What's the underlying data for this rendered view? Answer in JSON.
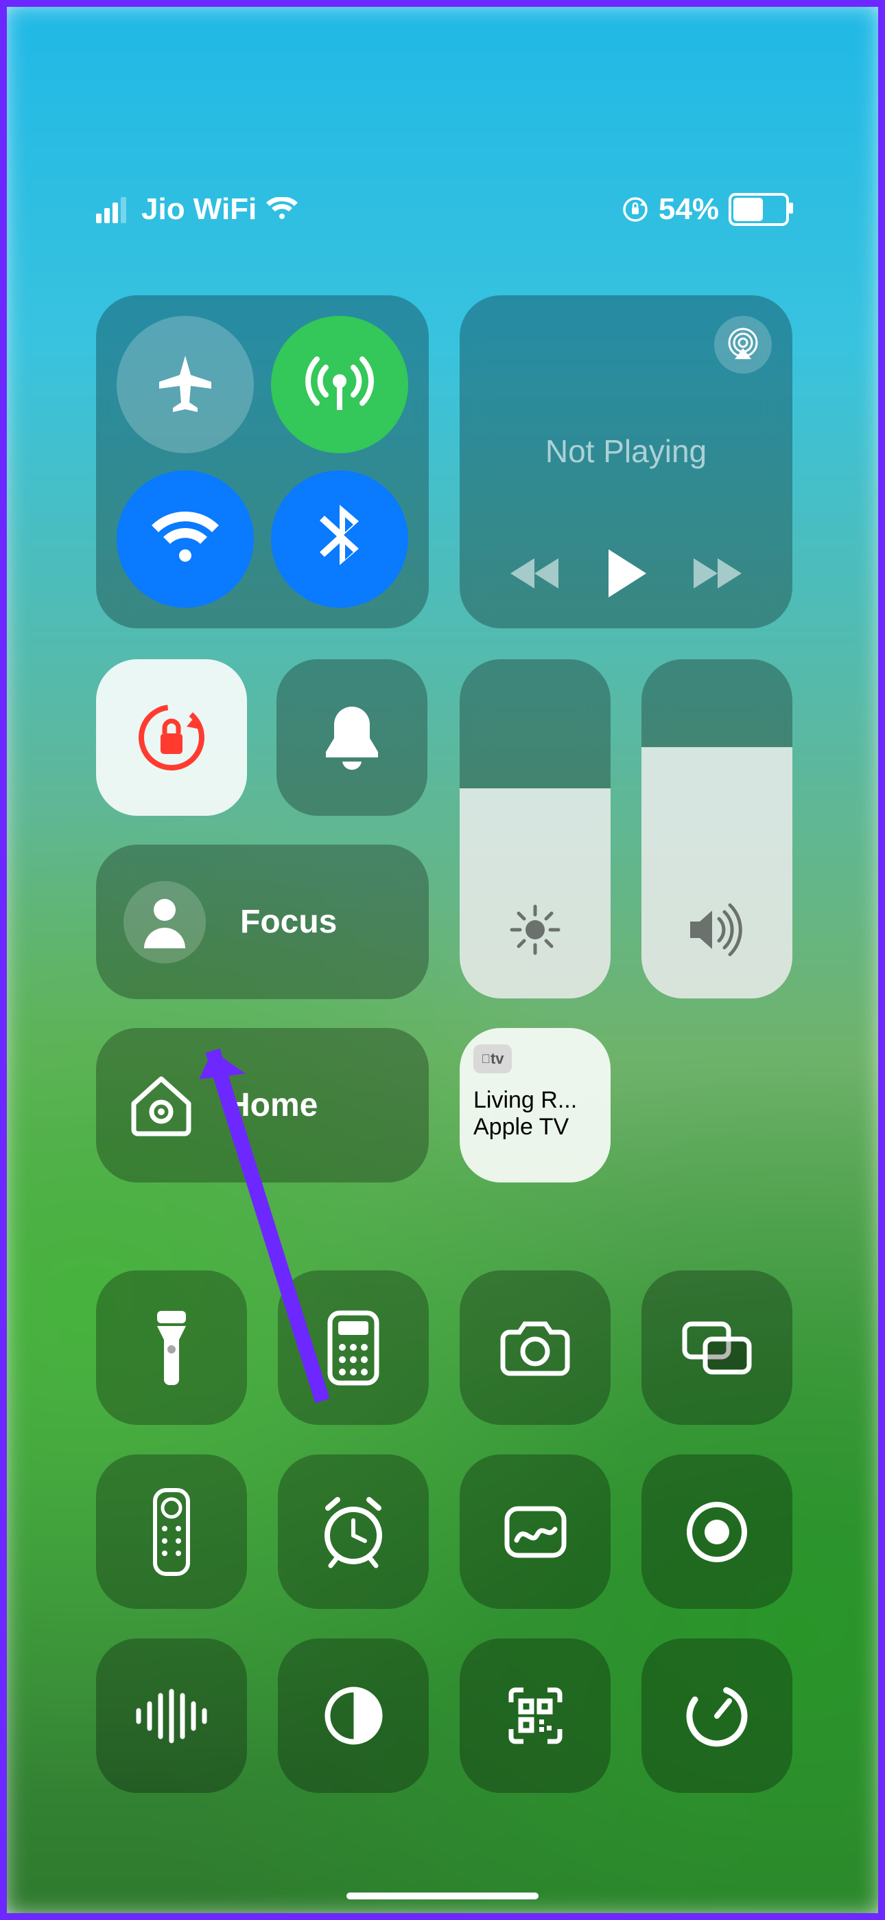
{
  "status": {
    "carrier": "Jio WiFi",
    "battery_percent": "54%"
  },
  "connectivity": {
    "airplane": {
      "on": false,
      "icon": "airplane-icon"
    },
    "cellular": {
      "on": true,
      "icon": "cellular-antenna-icon"
    },
    "wifi": {
      "on": true,
      "icon": "wifi-icon"
    },
    "bluetooth": {
      "on": true,
      "icon": "bluetooth-icon"
    }
  },
  "media": {
    "status_text": "Not Playing"
  },
  "orientation_lock": {
    "on": true
  },
  "silent_mode": {
    "on": false
  },
  "brightness": {
    "level_percent": 62
  },
  "volume": {
    "level_percent": 74
  },
  "focus": {
    "label": "Focus",
    "icon": "person-icon"
  },
  "home": {
    "label": "Home",
    "icon": "home-icon"
  },
  "apple_tv_remote": {
    "badge": "tv",
    "line1": "Living R...",
    "line2": "Apple TV"
  },
  "bottom_controls": [
    {
      "id": "flashlight",
      "icon": "flashlight-icon"
    },
    {
      "id": "calculator",
      "icon": "calculator-icon"
    },
    {
      "id": "camera",
      "icon": "camera-icon"
    },
    {
      "id": "screen-mirroring",
      "icon": "screen-mirroring-icon"
    },
    {
      "id": "tv-remote",
      "icon": "tv-remote-icon"
    },
    {
      "id": "alarm",
      "icon": "alarm-clock-icon"
    },
    {
      "id": "freeform",
      "icon": "freeform-icon"
    },
    {
      "id": "screen-record",
      "icon": "screen-record-icon"
    },
    {
      "id": "sound-recognition",
      "icon": "sound-wave-icon"
    },
    {
      "id": "dark-mode",
      "icon": "dark-mode-icon"
    },
    {
      "id": "qr-scanner",
      "icon": "qr-code-icon"
    },
    {
      "id": "timer",
      "icon": "timer-icon"
    }
  ],
  "annotation": {
    "target": "focus-button",
    "color": "#6d28ff"
  }
}
